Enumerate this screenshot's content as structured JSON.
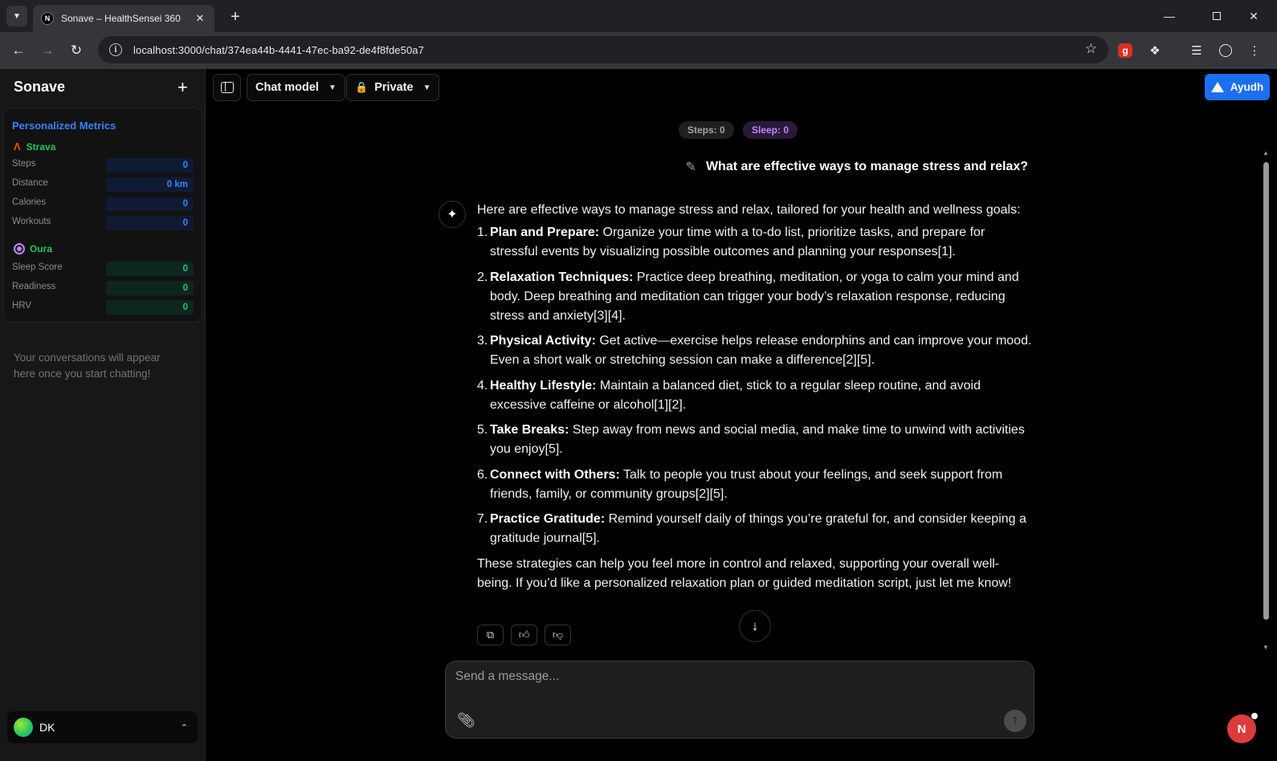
{
  "browser": {
    "tab_title": "Sonave – HealthSensei 360",
    "favicon_letter": "N",
    "url": "localhost:3000/chat/374ea44b-4441-47ec-ba92-de4f8fde50a7"
  },
  "sidebar": {
    "brand": "Sonave",
    "metrics_title": "Personalized Metrics",
    "strava": {
      "name": "Strava",
      "rows": [
        {
          "label": "Steps",
          "value": "0"
        },
        {
          "label": "Distance",
          "value": "0 km"
        },
        {
          "label": "Calories",
          "value": "0"
        },
        {
          "label": "Workouts",
          "value": "0"
        }
      ]
    },
    "oura": {
      "name": "Oura",
      "rows": [
        {
          "label": "Sleep Score",
          "value": "0"
        },
        {
          "label": "Readiness",
          "value": "0"
        },
        {
          "label": "HRV",
          "value": "0"
        }
      ]
    },
    "empty_note": "Your conversations will appear here once you start chatting!",
    "user_name": "DK"
  },
  "header": {
    "model_label": "Chat model",
    "visibility_label": "Private",
    "deploy_label": "Ayudh"
  },
  "stats": {
    "steps": "Steps: 0",
    "sleep": "Sleep: 0"
  },
  "chat": {
    "user_message": "What are effective ways to manage stress and relax?",
    "intro": "Here are effective ways to manage stress and relax, tailored for your health and wellness goals:",
    "items": [
      {
        "num": "1.",
        "title": "Plan and Prepare:",
        "text": " Organize your time with a to-do list, prioritize tasks, and prepare for stressful events by visualizing possible outcomes and planning your responses[1]."
      },
      {
        "num": "2.",
        "title": "Relaxation Techniques:",
        "text": " Practice deep breathing, meditation, or yoga to calm your mind and body. Deep breathing and meditation can trigger your body’s relaxation response, reducing stress and anxiety[3][4]."
      },
      {
        "num": "3.",
        "title": "Physical Activity:",
        "text": " Get active—exercise helps release endorphins and can improve your mood. Even a short walk or stretching session can make a difference[2][5]."
      },
      {
        "num": "4.",
        "title": "Healthy Lifestyle:",
        "text": " Maintain a balanced diet, stick to a regular sleep routine, and avoid excessive caffeine or alcohol[1][2]."
      },
      {
        "num": "5.",
        "title": "Take Breaks:",
        "text": " Step away from news and social media, and make time to unwind with activities you enjoy[5]."
      },
      {
        "num": "6.",
        "title": "Connect with Others:",
        "text": " Talk to people you trust about your feelings, and seek support from friends, family, or community groups[2][5]."
      },
      {
        "num": "7.",
        "title": "Practice Gratitude:",
        "text": " Remind yourself daily of things you’re grateful for, and consider keeping a gratitude journal[5]."
      }
    ],
    "outro": "These strategies can help you feel more in control and relaxed, supporting your overall well-being. If you’d like a personalized relaxation plan or guided meditation script, just let me know!"
  },
  "composer": {
    "placeholder": "Send a message..."
  },
  "floating_badge": "N"
}
